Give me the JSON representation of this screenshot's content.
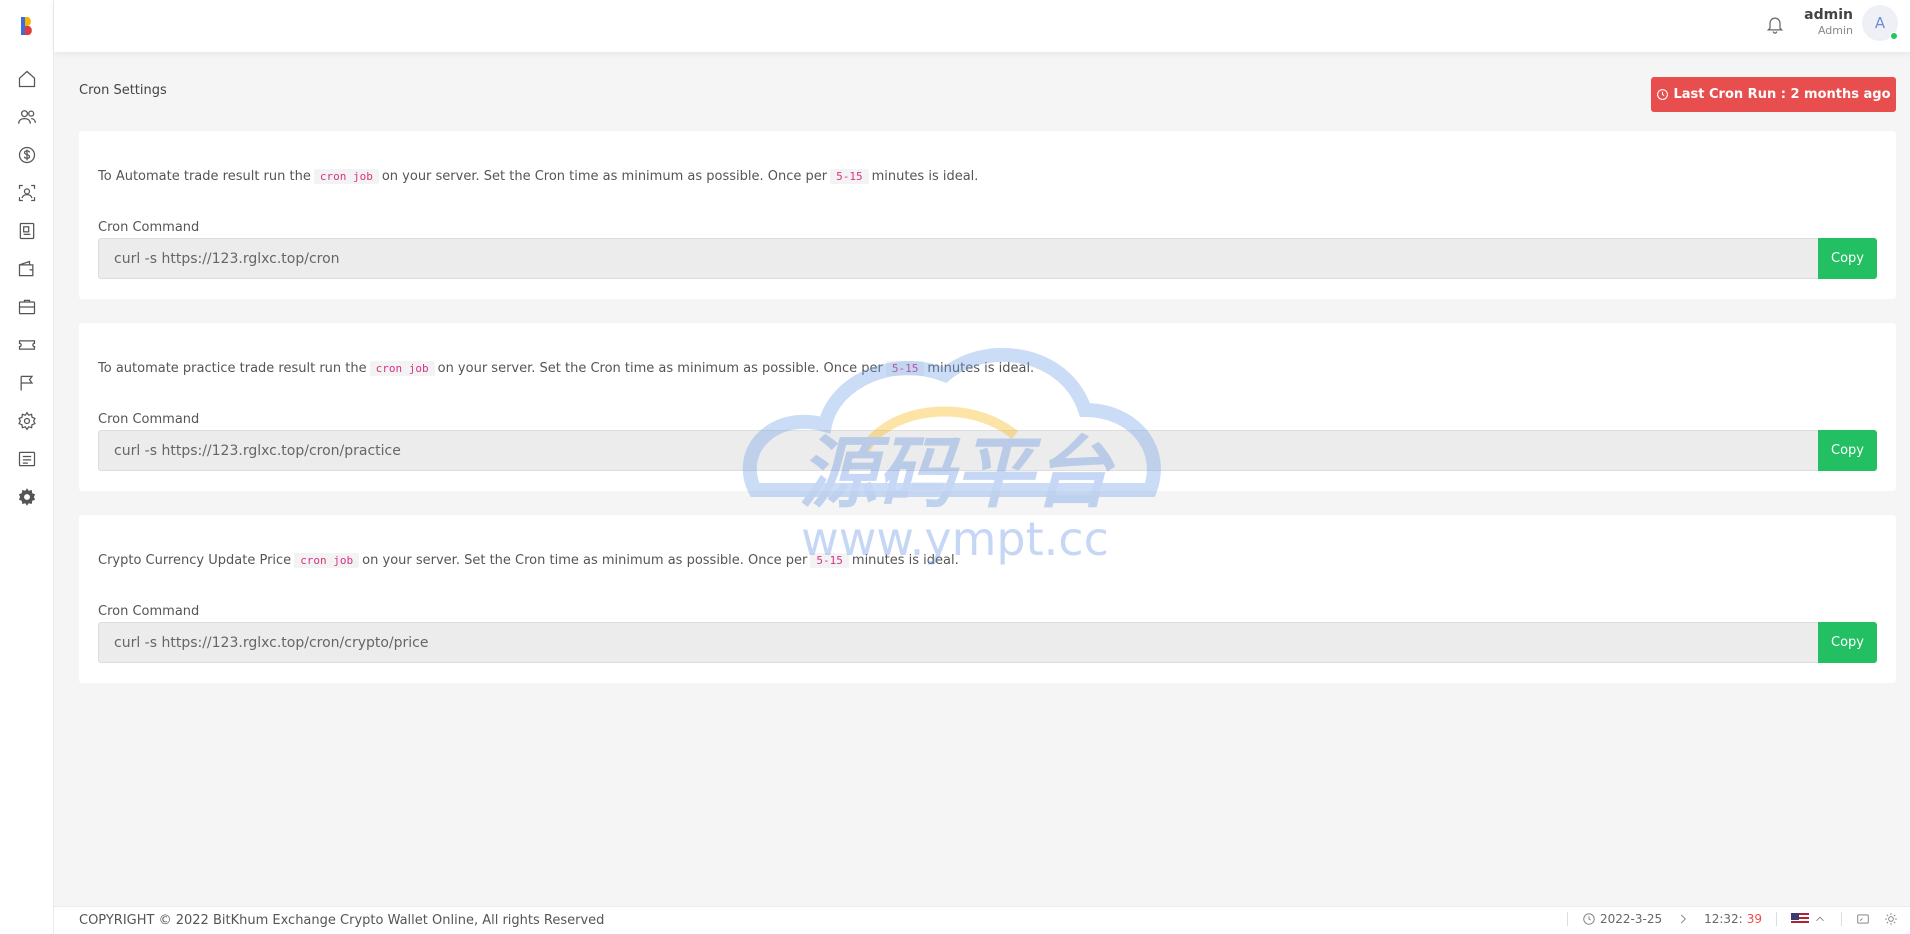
{
  "user": {
    "name": "admin",
    "role": "Admin",
    "initial": "A"
  },
  "page": {
    "title": "Cron Settings",
    "last_cron": "Last Cron Run : 2 months ago"
  },
  "cards": [
    {
      "desc_before": "To Automate trade result run the",
      "code": "cron job",
      "desc_middle": "on your server. Set the Cron time as minimum as possible. Once per",
      "interval": "5-15",
      "desc_after": "minutes is ideal.",
      "label": "Cron Command",
      "command": "curl -s https://123.rglxc.top/cron",
      "copy_label": "Copy"
    },
    {
      "desc_before": "To automate practice trade result run the",
      "code": "cron job",
      "desc_middle": "on your server. Set the Cron time as minimum as possible. Once per",
      "interval": "5-15",
      "desc_after": "minutes is ideal.",
      "label": "Cron Command",
      "command": "curl -s https://123.rglxc.top/cron/practice",
      "copy_label": "Copy"
    },
    {
      "desc_before": "Crypto Currency Update Price",
      "code": "cron job",
      "desc_middle": "on your server. Set the Cron time as minimum as possible. Once per",
      "interval": "5-15",
      "desc_after": "minutes is ideal.",
      "label": "Cron Command",
      "command": "curl -s https://123.rglxc.top/cron/crypto/price",
      "copy_label": "Copy"
    }
  ],
  "watermark": {
    "cn": "源码平台",
    "url": "www.ympt.cc"
  },
  "footer": {
    "copyright": "COPYRIGHT © 2022 BitKhum Exchange Crypto Wallet Online, All rights Reserved",
    "date": "2022-3-25",
    "time_hm": "12:32:",
    "time_sec": "39"
  },
  "colors": {
    "danger": "#e84e4e",
    "success": "#22c063",
    "code": "#d63384"
  },
  "icons": {
    "sidebar": [
      "home-icon",
      "users-icon",
      "dollar-icon",
      "user-scan-icon",
      "document-icon",
      "wallet-icon",
      "briefcase-icon",
      "ticket-icon",
      "flag-icon",
      "settings-icon",
      "list-icon",
      "gear-icon"
    ]
  }
}
